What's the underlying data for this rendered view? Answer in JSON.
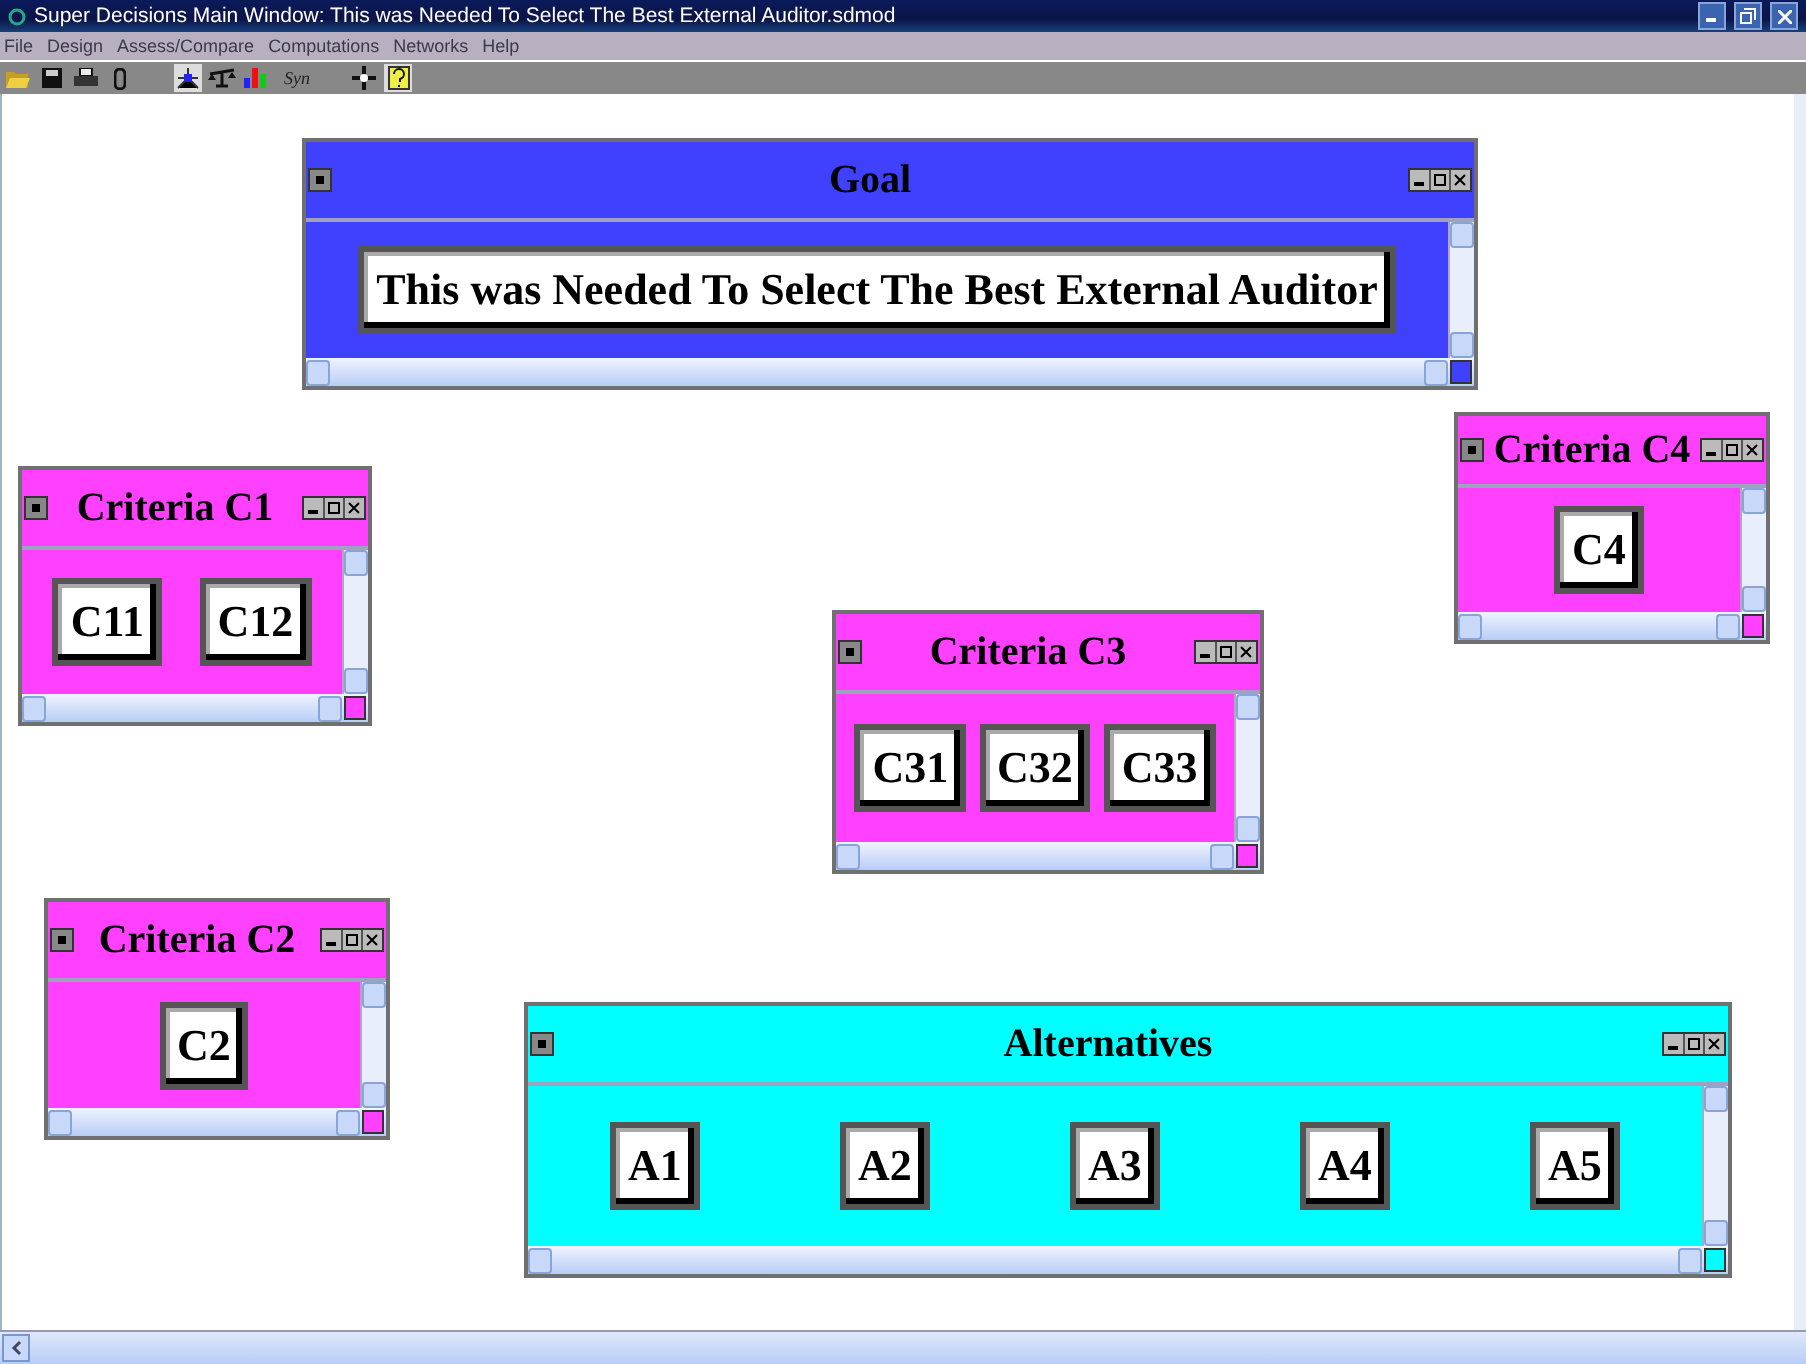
{
  "window": {
    "title": "Super Decisions Main Window: This was Needed To Select The Best External Auditor.sdmod"
  },
  "menu": [
    "File",
    "Design",
    "Assess/Compare",
    "Computations",
    "Networks",
    "Help"
  ],
  "toolbar": {
    "syn_label": "Syn"
  },
  "clusters": [
    {
      "title": "Goal",
      "color": "#4040ff",
      "nodes": [
        "This was Needed To Select The Best External Auditor"
      ]
    },
    {
      "title": "Criteria C1",
      "color": "#ff40ff",
      "nodes": [
        "C11",
        "C12"
      ]
    },
    {
      "title": "Criteria C2",
      "color": "#ff40ff",
      "nodes": [
        "C2"
      ]
    },
    {
      "title": "Criteria C3",
      "color": "#ff40ff",
      "nodes": [
        "C31",
        "C32",
        "C33"
      ]
    },
    {
      "title": "Criteria C4",
      "color": "#ff40ff",
      "nodes": [
        "C4"
      ]
    },
    {
      "title": "Alternatives",
      "color": "#00ffff",
      "nodes": [
        "A1",
        "A2",
        "A3",
        "A4",
        "A5"
      ]
    }
  ]
}
